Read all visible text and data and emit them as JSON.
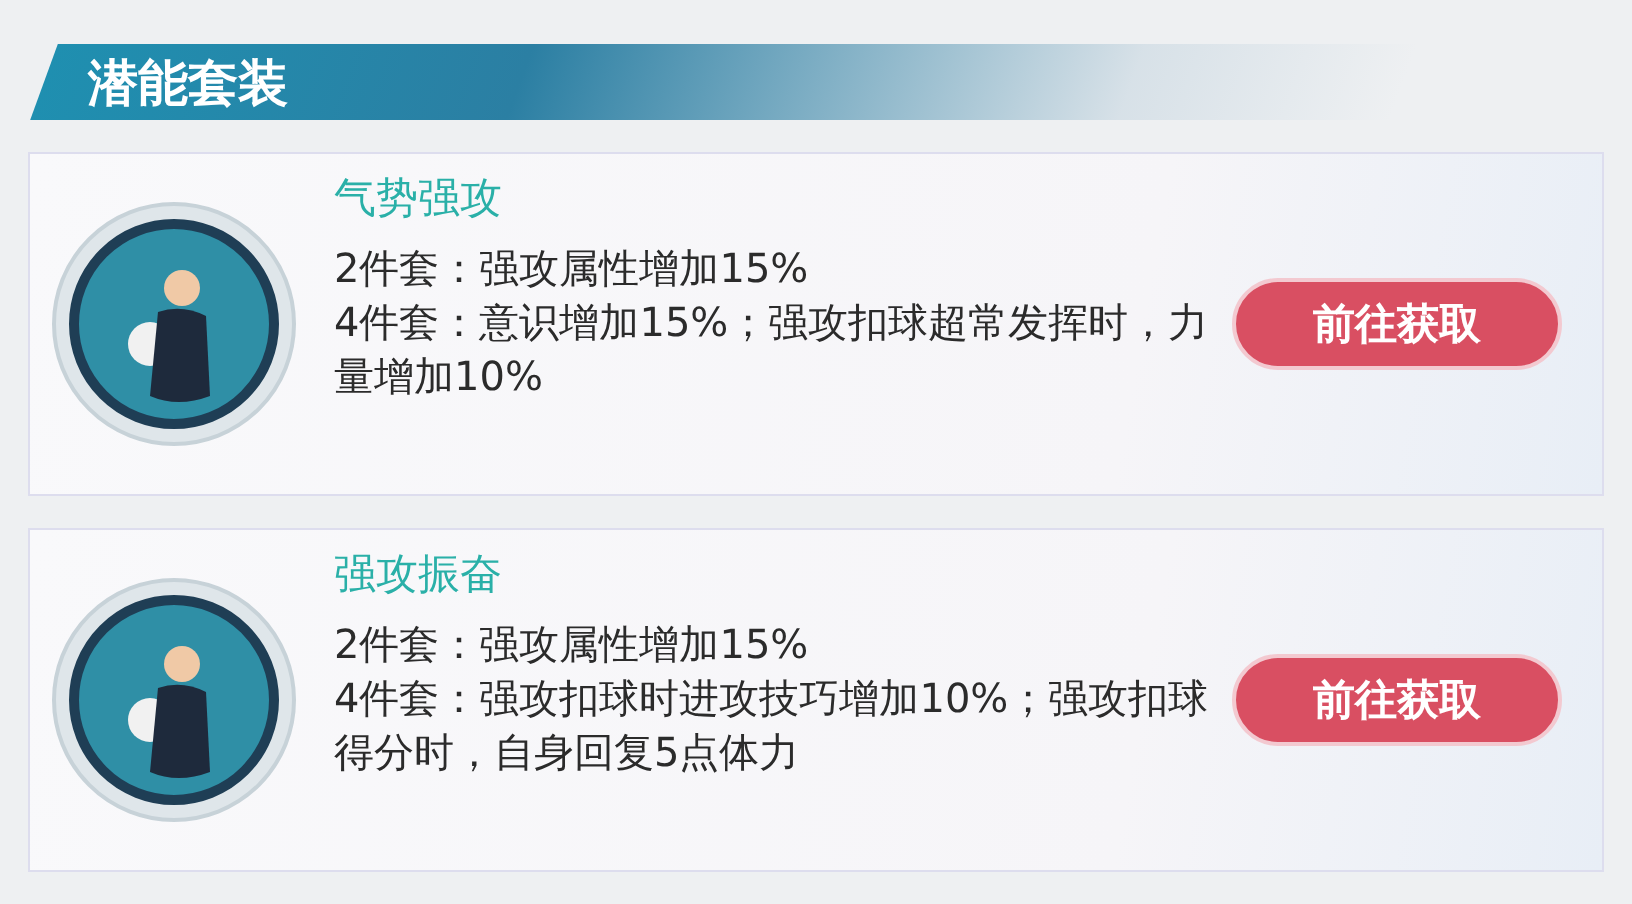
{
  "section_title": "潜能套装",
  "sets": [
    {
      "name": "气势强攻",
      "bonuses": [
        "2件套：强攻属性增加15%",
        "4件套：意识增加15%；强攻扣球超常发挥时，力量增加10%"
      ],
      "button": "前往获取"
    },
    {
      "name": "强攻振奋",
      "bonuses": [
        "2件套：强攻属性增加15%",
        "4件套：强攻扣球时进攻技巧增加10%；强攻扣球得分时，自身回复5点体力"
      ],
      "button": "前往获取"
    }
  ]
}
